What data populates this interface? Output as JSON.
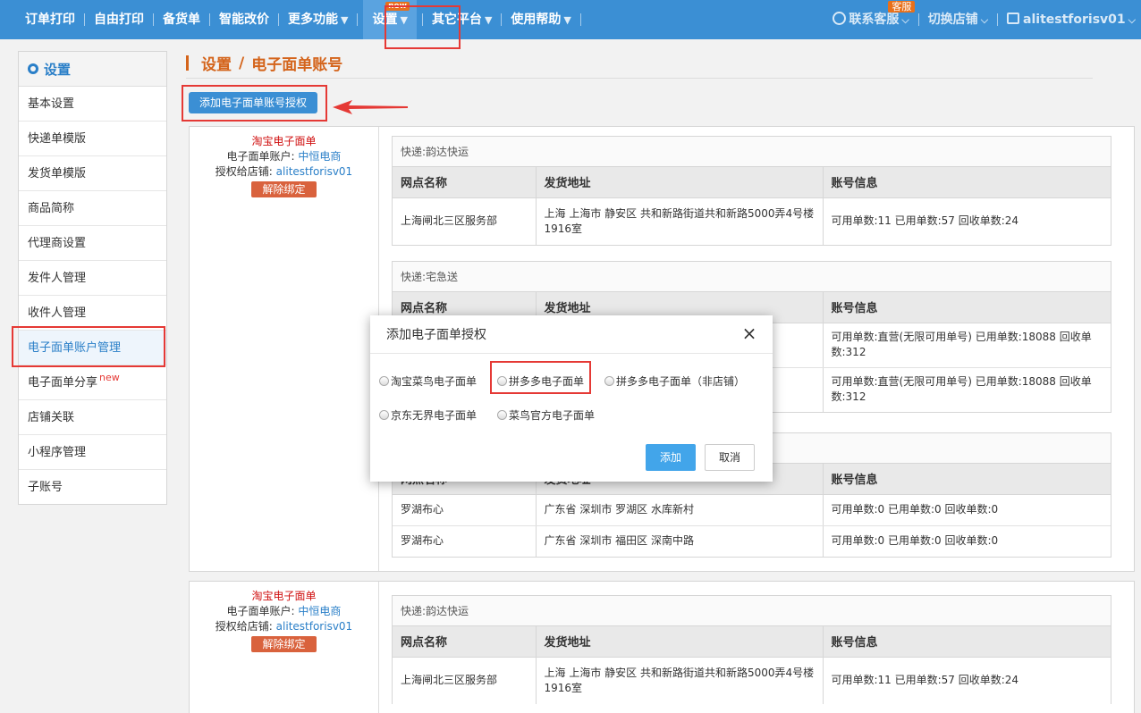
{
  "nav": {
    "items": [
      {
        "label": "订单打印",
        "caret": ""
      },
      {
        "label": "自由打印",
        "caret": ""
      },
      {
        "label": "备货单",
        "caret": ""
      },
      {
        "label": "智能改价",
        "caret": ""
      },
      {
        "label": "更多功能",
        "caret": "▼"
      },
      {
        "label": "设置",
        "caret": "▼",
        "badge": "new"
      },
      {
        "label": "其它平台",
        "caret": "▼"
      },
      {
        "label": "使用帮助",
        "caret": "▼"
      }
    ],
    "service_label": "联系客服",
    "service_badge": "客服",
    "switch_shop": "切换店铺",
    "user": "alitestforisv01"
  },
  "sidebar": {
    "title": "设置",
    "items": [
      {
        "label": "基本设置"
      },
      {
        "label": "快递单模版"
      },
      {
        "label": "发货单模版"
      },
      {
        "label": "商品简称"
      },
      {
        "label": "代理商设置"
      },
      {
        "label": "发件人管理"
      },
      {
        "label": "收件人管理"
      },
      {
        "label": "电子面单账户管理"
      },
      {
        "label": "电子面单分享",
        "tag": "new"
      },
      {
        "label": "店铺关联"
      },
      {
        "label": "小程序管理"
      },
      {
        "label": "子账号"
      }
    ]
  },
  "breadcrumb": {
    "root": "设置",
    "sep": "/",
    "current": "电子面单账号"
  },
  "add_button": "添加电子面单账号授权",
  "panels": [
    {
      "account_type": "淘宝电子面单",
      "account_label": "电子面单账户:",
      "account_name": "中恒电商",
      "shop_label": "授权给店铺:",
      "shop_name": "alitestforisv01",
      "unbind": "解除绑定",
      "blocks": [
        {
          "express": "快递:韵达快运",
          "headers": [
            "网点名称",
            "发货地址",
            "账号信息"
          ],
          "rows": [
            [
              "上海闸北三区服务部",
              "上海 上海市 静安区 共和新路街道共和新路5000弄4号楼1916室",
              "可用单数:11 已用单数:57 回收单数:24"
            ]
          ]
        },
        {
          "express": "快递:宅急送",
          "headers": [
            "网点名称",
            "发货地址",
            "账号信息"
          ],
          "rows": [
            [
              "",
              "",
              "可用单数:直营(无限可用单号) 已用单数:18088 回收单数:312"
            ],
            [
              "",
              "",
              "可用单数:直营(无限可用单号) 已用单数:18088 回收单数:312"
            ]
          ]
        },
        {
          "express": "",
          "headers": [
            "网点名称",
            "发货地址",
            "账号信息"
          ],
          "rows": [
            [
              "罗湖布心",
              "广东省 深圳市 罗湖区 水库新村",
              "可用单数:0 已用单数:0 回收单数:0"
            ],
            [
              "罗湖布心",
              "广东省 深圳市 福田区 深南中路",
              "可用单数:0 已用单数:0 回收单数:0"
            ]
          ]
        }
      ]
    },
    {
      "account_type": "淘宝电子面单",
      "account_label": "电子面单账户:",
      "account_name": "中恒电商",
      "shop_label": "授权给店铺:",
      "shop_name": "alitestforisv01",
      "unbind": "解除绑定",
      "blocks": [
        {
          "express": "快递:韵达快运",
          "headers": [
            "网点名称",
            "发货地址",
            "账号信息"
          ],
          "rows": [
            [
              "上海闸北三区服务部",
              "上海 上海市 静安区 共和新路街道共和新路5000弄4号楼1916室",
              "可用单数:11 已用单数:57 回收单数:24"
            ]
          ]
        }
      ]
    }
  ],
  "modal": {
    "title": "添加电子面单授权",
    "options": [
      "淘宝菜鸟电子面单",
      "拼多多电子面单",
      "拼多多电子面单（非店铺）",
      "京东无界电子面单",
      "菜鸟官方电子面单"
    ],
    "ok": "添加",
    "cancel": "取消"
  }
}
